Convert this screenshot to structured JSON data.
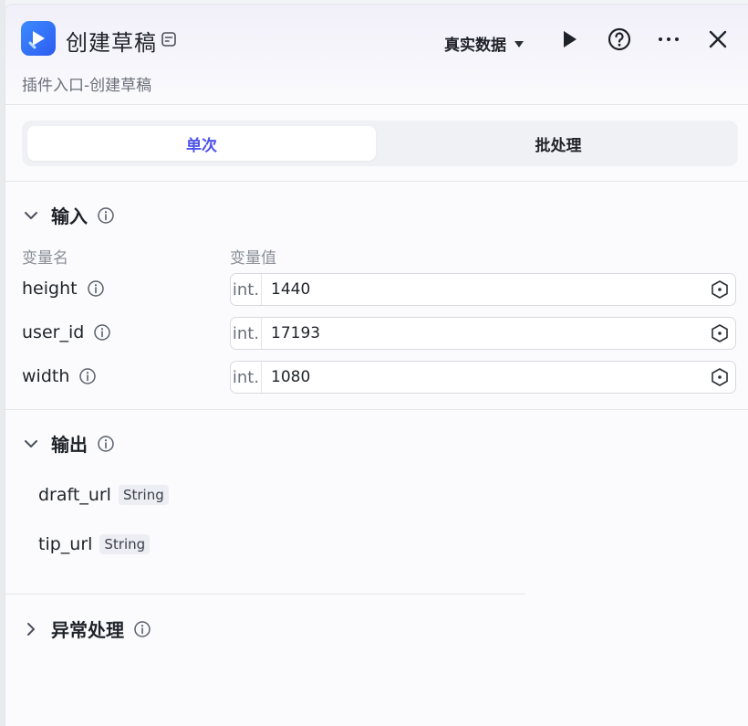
{
  "header": {
    "title": "创建草稿",
    "subtitle": "插件入口-创建草稿",
    "data_source": "真实数据"
  },
  "mode_tabs": [
    "单次",
    "批处理"
  ],
  "input_section": {
    "title": "输入",
    "col_name": "变量名",
    "col_value": "变量值",
    "rows": [
      {
        "name": "height",
        "type": "int.",
        "value": "1440"
      },
      {
        "name": "user_id",
        "type": "int.",
        "value": "17193"
      },
      {
        "name": "width",
        "type": "int.",
        "value": "1080"
      }
    ]
  },
  "output_section": {
    "title": "输出",
    "items": [
      {
        "name": "draft_url",
        "type": "String"
      },
      {
        "name": "tip_url",
        "type": "String"
      }
    ]
  },
  "error_section": {
    "title": "异常处理"
  },
  "colors": {
    "accent": "#4d53e8",
    "app_icon": "#2d5cf0"
  }
}
